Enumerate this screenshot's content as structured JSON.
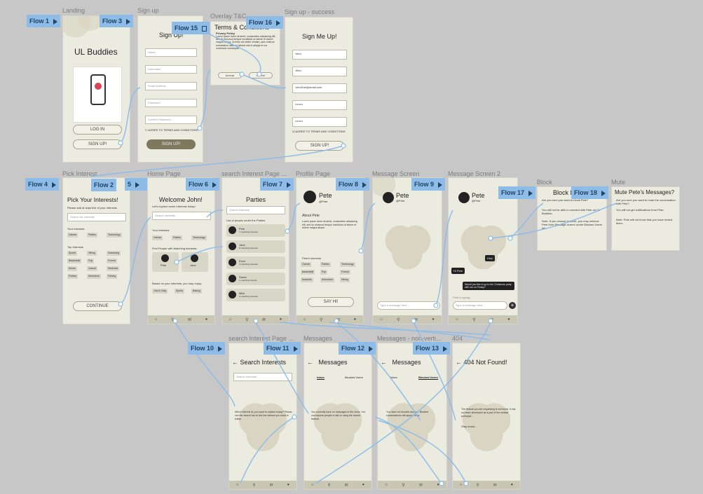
{
  "flows": [
    "Flow 1",
    "Flow 3",
    "Flow 15",
    "Flow 16",
    "Flow 4",
    "Flow 2",
    "5",
    "Flow 6",
    "Flow 7",
    "Flow 8",
    "Flow 9",
    "Flow 17",
    "Flow 18",
    "Flow 10",
    "Flow 11",
    "Flow 12",
    "Flow 13"
  ],
  "frame_titles": {
    "landing": "Landing",
    "signup": "Sign up",
    "overlay": "Overlay T&C",
    "signup_success": "Sign up - success",
    "pick_interest": "Pick Interest",
    "home": "Home Page",
    "search_interest_page": "search Interest Page ...",
    "profile": "Profile Page",
    "message_screen": "Message Screen",
    "message_screen_2": "Message Screen 2",
    "block": "Block",
    "mute": "Mute",
    "search_interest_page_2": "search Interest Page ...",
    "messages": "Messages",
    "messages_nonverti_1": "Messages - non-verti...",
    "messages_nonverti_2": "Messages - non-verti...",
    "not_found": "404"
  },
  "landing": {
    "app_name": "UL Buddies",
    "login": "LOG IN",
    "signup": "SIGN UP!"
  },
  "signup": {
    "heading": "Sign Up!",
    "fields": [
      "Name",
      "Username",
      "Email Address",
      "Password",
      "Confirm Password"
    ],
    "agree": "AGREE TO TERMS AND CONDITIONS",
    "button": "SIGN UP!"
  },
  "overlay": {
    "heading": "Terms & Conditions",
    "policy": "Privacy Policy",
    "body": "Lorem ipsum dolor sit amet, consectetur adipiscing elit, sed do eiusmod tempor incididunt ut labore et dolore magna aliqua. Ut enim ad minim veniam, quis nostrud exercitation ullamco laboris nisi ut aliquip ex ea commodo consequat.",
    "accept": "Accept",
    "cancel": "Cancel"
  },
  "success": {
    "heading": "Sign Me Up!",
    "fields": [
      {
        "label": "Name",
        "value": "John"
      },
      {
        "label": "Username",
        "value": "J0hn"
      },
      {
        "label": "Email Address",
        "value": "JohnDoe@email.com"
      },
      {
        "label": "Password",
        "value": "••••••••"
      },
      {
        "label": "Confirm Password",
        "value": "••••••••"
      }
    ],
    "agree": "AGREE TO TERMS AND CONDITIONS",
    "button": "SIGN UP!"
  },
  "pick": {
    "heading": "Pick Your Interests!",
    "subtitle": "Please add at least five of your interests",
    "search": "Search for interests",
    "your_interests": "Your Interests",
    "chips": [
      "Games",
      "Parties",
      "Technology"
    ],
    "top_label": "Top Interests",
    "top": [
      "Sports",
      "Hiking",
      "Swimming",
      "Basketball",
      "Pop",
      "Formal",
      "Anime",
      "Casual",
      "Sketches",
      "Politics",
      "Adventure",
      "Fishing"
    ],
    "continue": "CONTINUE"
  },
  "home": {
    "heading": "Welcome John!",
    "question": "Let's explore some interests today!",
    "search": "Search Interests",
    "your_interests": "Your Interests",
    "chips": [
      "Games",
      "Parties",
      "Technology"
    ],
    "find": "Find People with Matching Interests:",
    "people": [
      {
        "name": "Pete",
        "meta": "7 matching interests"
      },
      {
        "name": "Jane",
        "meta": "5 matching interests"
      }
    ],
    "based": "Based on your interests, you may enjoy:",
    "suggest": [
      "Just in Duty",
      "Sports",
      "Baking"
    ]
  },
  "parties": {
    "heading": "Parties",
    "search": "Search interests",
    "list_label": "List of people under the Parties",
    "people": [
      {
        "name": "Pete",
        "handle": "@Pete",
        "meta": "7 matching interests"
      },
      {
        "name": "Jane",
        "handle": "@Jane",
        "meta": "5 matching interests"
      },
      {
        "name": "Enzo",
        "handle": "@Enzo",
        "meta": "3 matching interests"
      },
      {
        "name": "Sarah",
        "handle": "@Sarah",
        "meta": "1 matching interest"
      },
      {
        "name": "Mike",
        "handle": "@Mike",
        "meta": "2 matching interests"
      }
    ]
  },
  "profile": {
    "name": "Pete",
    "handle": "@Pete",
    "about_label": "About Pete",
    "about": "Lorem ipsum dolor sit amet, consectetur adipiscing elit, sed do eiusmod tempor incididunt ut labore et dolore magna aliqua.",
    "interests_label": "Pete's interests",
    "chips": [
      "Games",
      "Parties",
      "Technology",
      "Basketball",
      "Pop",
      "Formal",
      "Musicals",
      "Adventure",
      "Hiking"
    ],
    "say_hi": "SAY HI!"
  },
  "message": {
    "name": "Pete",
    "handle": "@Pete",
    "placeholder": "Type a message here..."
  },
  "message2": {
    "name": "Pete",
    "handle": "@Pete",
    "msgs": [
      "Hey!",
      "Hi Pete",
      "Would you like to go to the Christmas party with me on Friday?"
    ],
    "typing": "Pete is typing...",
    "placeholder": "Type a message here..."
  },
  "block": {
    "heading": "Block Pete?",
    "lines": [
      "Are you sure you want to block Pete?",
      "You will not be able to connect with Pete on UL Buddies.",
      "Note: If you choose to block, you may unblock Pete from Message screen under Blocked Users tab"
    ]
  },
  "mute": {
    "heading": "Mute Pete's Messages?",
    "lines": [
      "Are you sure you want to mute the conversation with Pete?",
      "You will not get notifications from Pete.",
      "Note: Pete will not know that you have muted them."
    ]
  },
  "search2": {
    "heading": "Search Interests",
    "search": "Search interests",
    "empty": "Which interest do you want to explore today? Please use the search bar to find the interest you want to follow."
  },
  "messages": {
    "heading": "Messages",
    "tabs": [
      "Inbox",
      "Blocked Users"
    ],
    "empty": "You currently have no messages in the inbox. You can explore people to talk to using the search feature."
  },
  "messages_blocked": {
    "heading": "Messages",
    "tabs": [
      "Inbox",
      "Blocked Users"
    ],
    "empty": "You have not blocked anyone. Blocked conversations will appear here."
  },
  "not_found": {
    "heading": "404 Not Found!",
    "body": "The feature you are requesting is not found. It has not been developed as a part of the vertical prototype.",
    "stay": "Stay tuned..."
  },
  "colors": {
    "canvas": "#c7c7c7",
    "screen": "#ecebe0",
    "flow_tag": "#8dbce8",
    "wire": "#8dbce8",
    "dark_button": "#7e785f"
  }
}
